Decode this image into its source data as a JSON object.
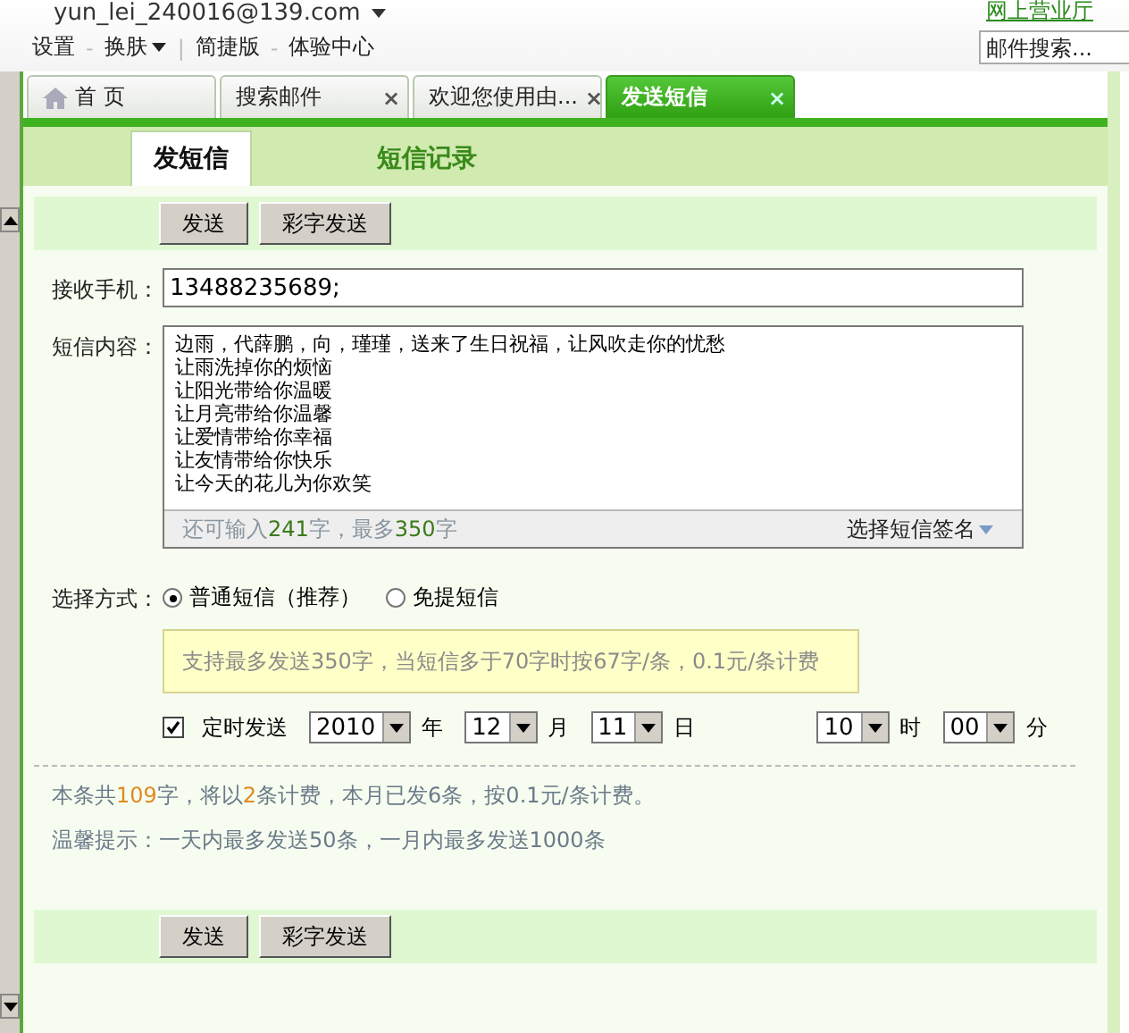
{
  "account": {
    "email": "yun_lei_240016@139.com",
    "link": "网上营业厅"
  },
  "top_menu": [
    {
      "label": "设置",
      "dropdown": false,
      "separator": "-"
    },
    {
      "label": "换肤",
      "dropdown": true,
      "separator": "|"
    },
    {
      "label": "简捷版",
      "dropdown": false,
      "separator": "-"
    },
    {
      "label": "体验中心",
      "dropdown": false
    }
  ],
  "search": {
    "placeholder": "邮件搜索..."
  },
  "tabs": [
    {
      "label": "首 页",
      "kind": "home",
      "selected": false
    },
    {
      "label": "搜索邮件",
      "kind": "page",
      "selected": false,
      "close": "×"
    },
    {
      "label": "欢迎您使用由...",
      "kind": "page",
      "selected": false,
      "close": "×"
    },
    {
      "label": "发送短信",
      "kind": "page",
      "selected": true,
      "close": "×"
    }
  ],
  "subtabs": [
    {
      "label": "发短信",
      "selected": true
    },
    {
      "label": "短信记录",
      "selected": false
    }
  ],
  "toolbar_buttons": [
    "发送",
    "彩字发送"
  ],
  "recipient": {
    "label": "接收手机：",
    "value": "13488235689;"
  },
  "content": {
    "label": "短信内容：",
    "lines": [
      "边雨，代薛鹏，向，瑾瑾，送来了生日祝福，让风吹走你的忧愁",
      "让雨洗掉你的烦恼",
      "让阳光带给你温暖",
      "让月亮带给你温馨",
      "让爱情带给你幸福",
      "让友情带给你快乐",
      "让今天的花儿为你欢笑"
    ],
    "remaining": "还可输入**241**字，最多**350**字",
    "signature": "选择短信签名"
  },
  "send_mode": {
    "label": "选择方式：",
    "options": [
      {
        "label": "普通短信（推荐）",
        "selected": true
      },
      {
        "label": "免提短信",
        "selected": false
      }
    ],
    "tip": "支持最多发送350字，当短信多于70字时按67字/条，0.1元/条计费"
  },
  "schedule": {
    "checked": true,
    "label": "定时发送",
    "date_fields": [
      {
        "value": "2010",
        "unit": "年"
      },
      {
        "value": "12",
        "unit": "月"
      },
      {
        "value": "11",
        "unit": "日"
      }
    ],
    "time_fields": [
      {
        "value": "10",
        "unit": "时"
      },
      {
        "value": "00",
        "unit": "分"
      }
    ]
  },
  "summary": "本条共**109**字，将以**2**条计费，本月已发6条，按0.1元/条计费。",
  "hint": "温馨提示：一天内最多发送50条，一月内最多发送1000条",
  "bottom_buttons": [
    "发送",
    "彩字发送"
  ]
}
